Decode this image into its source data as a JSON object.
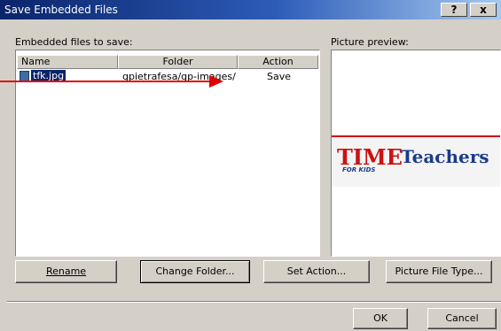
{
  "window": {
    "title": "Save Embedded Files",
    "help_glyph": "?",
    "close_glyph": "x"
  },
  "files_section": {
    "label": "Embedded files to save:",
    "columns": [
      "Name",
      "Folder",
      "Action"
    ],
    "rows": [
      {
        "name": "tfk.jpg",
        "folder": "gpietrafesa/gp-images/",
        "action": "Save"
      }
    ]
  },
  "preview_section": {
    "label": "Picture preview:",
    "image_text_main": "TIME",
    "image_text_sub": "FOR KIDS",
    "image_text_right": "Teachers"
  },
  "buttons": {
    "rename": "Rename",
    "change_folder": "Change Folder...",
    "set_action": "Set Action...",
    "picture_file_type": "Picture File Type...",
    "ok": "OK",
    "cancel": "Cancel"
  },
  "colors": {
    "dialog_bg": "#d4d0c8",
    "title_bar": "#0a246a",
    "arrow": "#e00000",
    "selection": "#0a246a"
  }
}
